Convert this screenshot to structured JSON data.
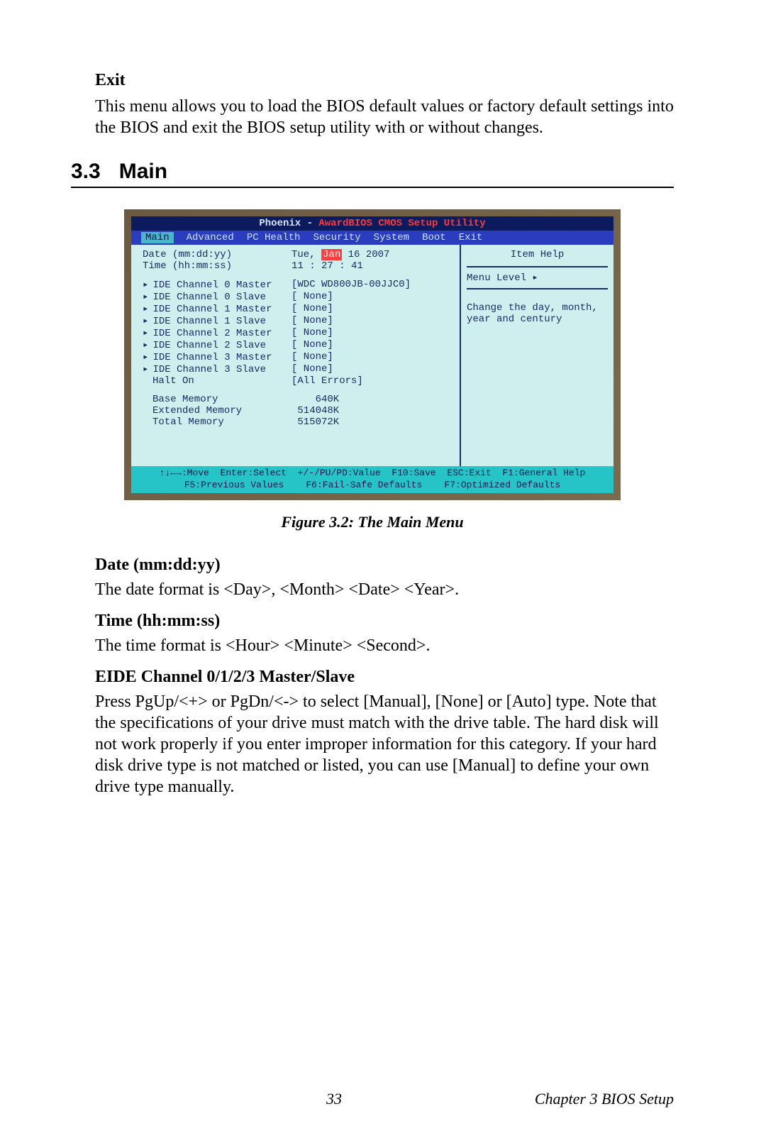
{
  "exit": {
    "heading": "Exit",
    "text": "This menu allows you to load the BIOS default values or factory default settings into the BIOS and exit the BIOS setup utility with or without changes."
  },
  "section": {
    "num": "3.3",
    "title": "Main"
  },
  "bios": {
    "title_pre": "Phoenix - ",
    "title_red": "AwardBIOS CMOS Setup Utility",
    "tabs": {
      "main": "Main",
      "advanced": "Advanced",
      "pchealth": "PC Health",
      "security": "Security",
      "system": "System",
      "boot": "Boot",
      "exit": "Exit"
    },
    "date_label": "Date (mm:dd:yy)",
    "date_val_pre": "Tue, ",
    "date_hi": "Jan",
    "date_val_post": " 16 2007",
    "time_label": "Time (hh:mm:ss)",
    "time_val": "11 : 27 : 41",
    "ide": [
      {
        "lab": "IDE Channel 0 Master",
        "val": "[WDC WD800JB-00JJC0]"
      },
      {
        "lab": "IDE Channel 0 Slave",
        "val": "[ None]"
      },
      {
        "lab": "IDE Channel 1 Master",
        "val": "[ None]"
      },
      {
        "lab": "IDE Channel 1 Slave",
        "val": "[ None]"
      },
      {
        "lab": "IDE Channel 2 Master",
        "val": "[ None]"
      },
      {
        "lab": "IDE Channel 2 Slave",
        "val": "[ None]"
      },
      {
        "lab": "IDE Channel 3 Master",
        "val": "[ None]"
      },
      {
        "lab": "IDE Channel 3 Slave",
        "val": "[ None]"
      }
    ],
    "halt_label": "Halt On",
    "halt_val": "[All Errors]",
    "mem": [
      {
        "lab": "Base Memory",
        "val": "    640K"
      },
      {
        "lab": "Extended Memory",
        "val": " 514048K"
      },
      {
        "lab": "Total Memory",
        "val": " 515072K"
      }
    ],
    "help_title": "Item Help",
    "menu_level": "Menu Level   ▸",
    "help_text": "Change the day, month, year and century",
    "foot1": "↑↓←→:Move  Enter:Select  +/-/PU/PD:Value  F10:Save  ESC:Exit  F1:General Help",
    "foot2": "F5:Previous Values    F6:Fail-Safe Defaults    F7:Optimized Defaults"
  },
  "figure_caption": "Figure 3.2: The Main Menu",
  "fields": {
    "date_h": "Date (mm:dd:yy)",
    "date_p": "The date format is <Day>, <Month> <Date> <Year>.",
    "time_h": "Time (hh:mm:ss)",
    "time_p": "The time format is <Hour> <Minute> <Second>.",
    "eide_h": "EIDE Channel 0/1/2/3 Master/Slave",
    "eide_p": "Press PgUp/<+> or PgDn/<-> to select [Manual], [None] or [Auto] type. Note that the specifications of your drive must match with the drive table. The hard disk will not work properly if you enter improper information for this category. If your hard disk drive type is not matched or listed, you can use [Manual] to define your own drive type manually."
  },
  "footer": {
    "page": "33",
    "chapter": "Chapter 3  BIOS Setup"
  }
}
